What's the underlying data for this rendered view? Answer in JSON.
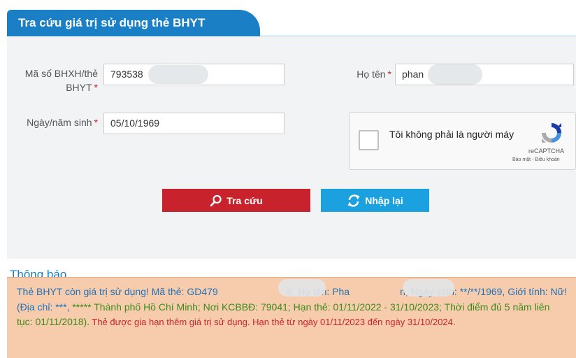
{
  "header": {
    "title": "Tra cứu giá trị sử dụng thẻ BHYT"
  },
  "form": {
    "bhxh_label_line1": "Mã số BHXH/thẻ",
    "bhxh_label_line2": "BHYT",
    "required_mark": "*",
    "bhxh_value": "793538",
    "name_label": "Họ tên",
    "name_value": "phan",
    "dob_label": "Ngày/năm sinh",
    "dob_value": "05/10/1969"
  },
  "captcha": {
    "text": "Tôi không phải là người máy",
    "brand": "reCAPTCHA",
    "links": "Bảo mật - Điều khoản"
  },
  "buttons": {
    "search_label": "Tra cứu",
    "reset_label": "Nhập lại"
  },
  "notice": {
    "title": "Thông báo",
    "part1": "Thẻ BHYT còn giá trị sử dụng! Mã thẻ: GD479",
    "part2": ".6, Họ tên: Pha",
    "part3": "n, Ngày sinh: **/**/1969, Giới tính: Nữ! (Địa chỉ: ***, ",
    "part4": "***** Thành phố Hồ Chí Minh; Nơi KCBBĐ: 79041; Hạn thẻ: 01/11/2022 - 31/10/2023; Thời điểm đủ 5 năm liên tục: 01/11/2018).",
    "part5": " Thẻ được gia hạn thêm giá trị sử dụng. Hạn thẻ từ ngày 01/11/2023 đến ngày 31/10/2024."
  },
  "colors": {
    "accent": "#1a7fc4",
    "search_button": "#c8232c",
    "reset_button": "#1ba1df",
    "notice_bg": "#f6ccad"
  },
  "icons": {
    "search": "search-icon",
    "refresh": "refresh-icon",
    "recaptcha": "recaptcha-logo-icon"
  }
}
